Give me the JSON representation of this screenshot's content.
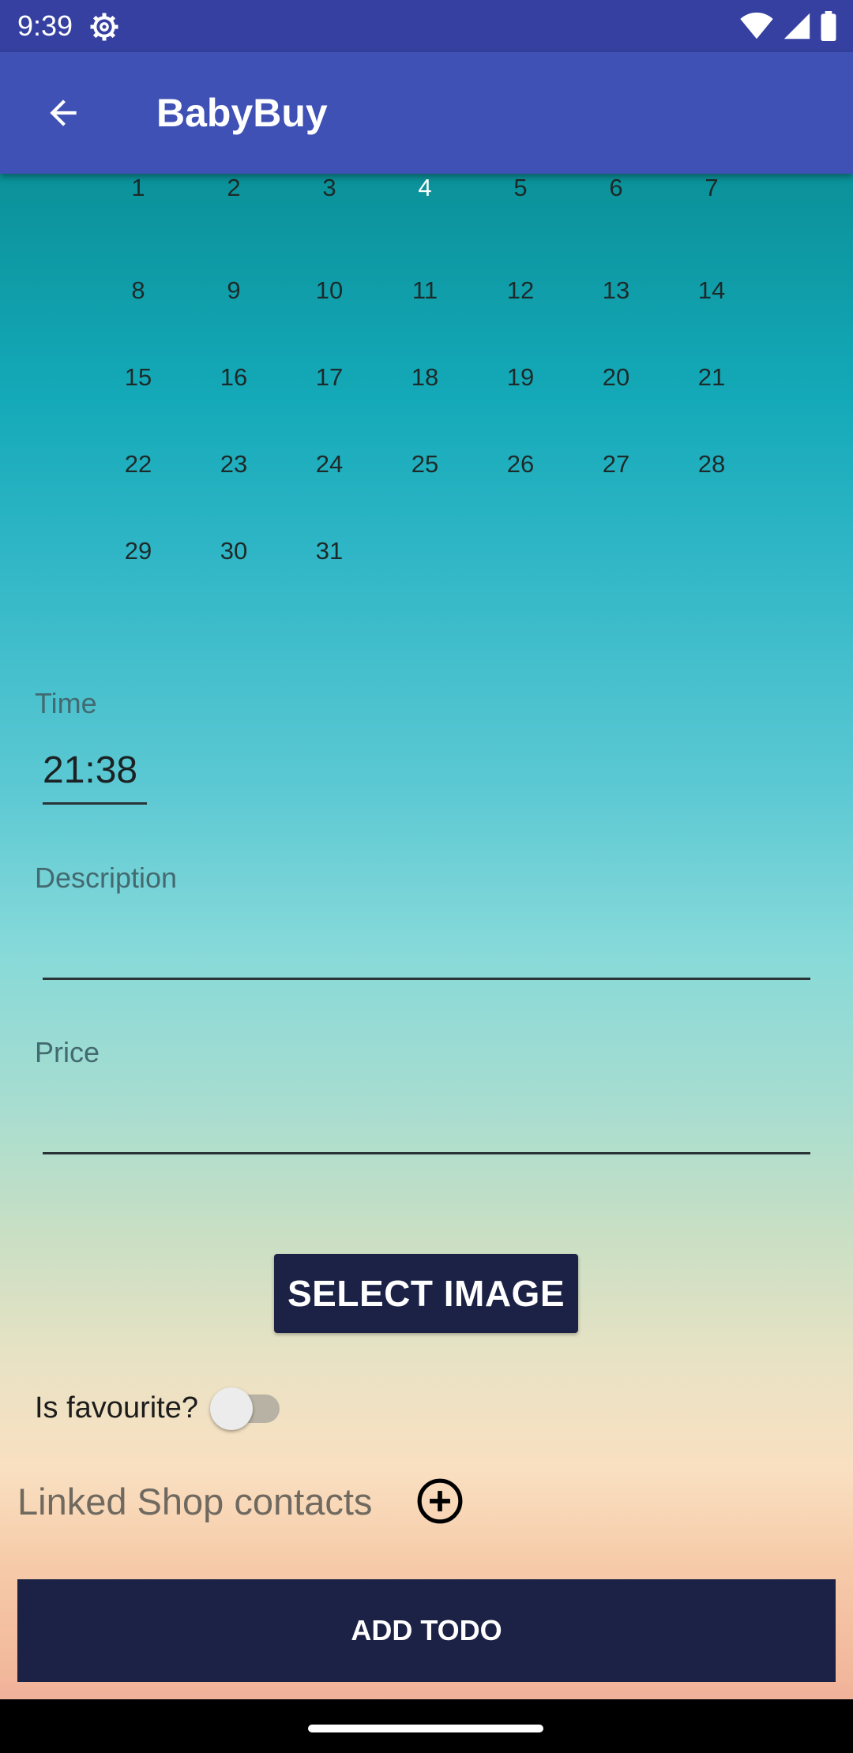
{
  "status_bar": {
    "time": "9:39",
    "icons": [
      "settings-gear-icon",
      "wifi-icon",
      "cellular-signal-icon",
      "battery-icon"
    ]
  },
  "app_bar": {
    "title": "BabyBuy",
    "back_icon": "arrow-back-icon",
    "color": "#3f51b5"
  },
  "calendar": {
    "selected_day": "4",
    "selected_color": "#ff2e7a",
    "weeks": [
      [
        "1",
        "2",
        "3",
        "4",
        "5",
        "6",
        "7"
      ],
      [
        "8",
        "9",
        "10",
        "11",
        "12",
        "13",
        "14"
      ],
      [
        "15",
        "16",
        "17",
        "18",
        "19",
        "20",
        "21"
      ],
      [
        "22",
        "23",
        "24",
        "25",
        "26",
        "27",
        "28"
      ],
      [
        "29",
        "30",
        "31"
      ]
    ]
  },
  "form": {
    "time_label": "Time",
    "time_value": "21:38",
    "description_label": "Description",
    "description_value": "",
    "price_label": "Price",
    "price_value": "",
    "select_image_label": "SELECT IMAGE",
    "favourite_label": "Is favourite?",
    "favourite_on": false,
    "linked_contacts_label": "Linked Shop contacts",
    "add_contact_icon": "add-circle-icon",
    "add_todo_label": "ADD TODO"
  },
  "colors": {
    "button_dark": "#1b2245"
  }
}
